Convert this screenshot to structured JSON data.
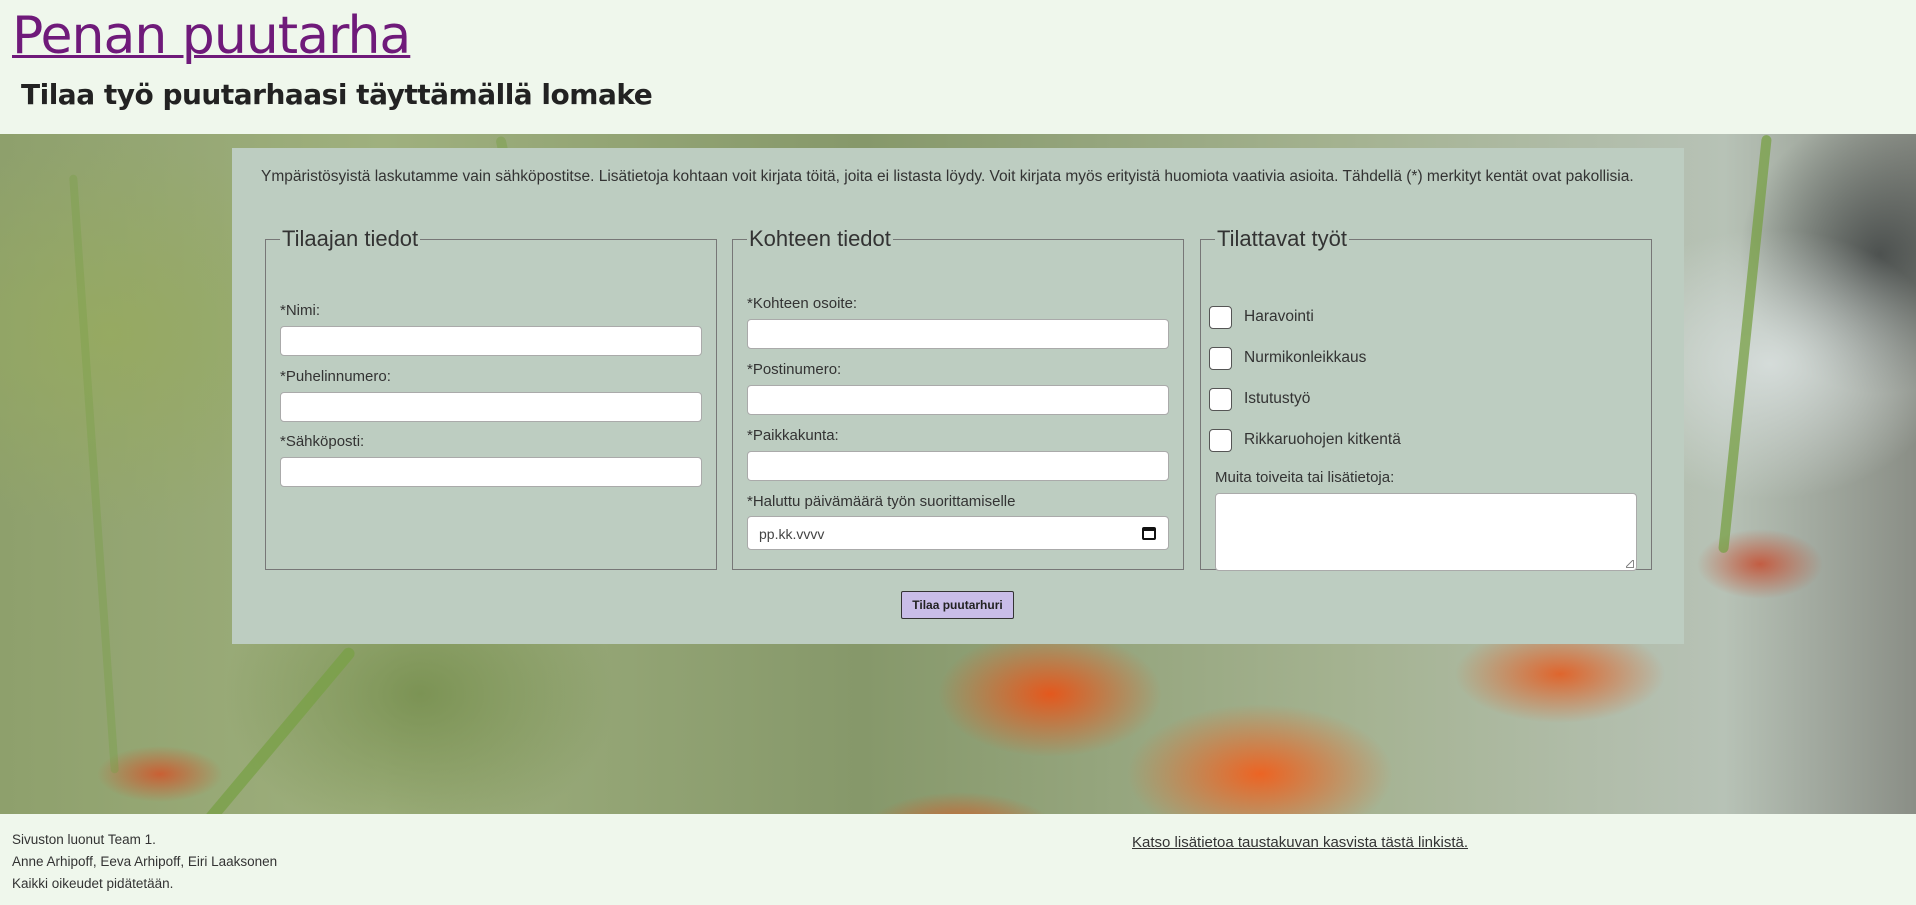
{
  "header": {
    "site_title": "Penan puutarha",
    "subtitle": "Tilaa työ puutarhaasi täyttämällä lomake"
  },
  "form": {
    "intro": "Ympäristösyistä laskutamme vain sähköpostitse. Lisätietoja kohtaan voit kirjata töitä, joita ei listasta löydy. Voit kirjata myös erityistä huomiota vaativia asioita. Tähdellä (*) merkityt kentät ovat pakollisia.",
    "customer": {
      "legend": "Tilaajan tiedot",
      "name_label": "*Nimi:",
      "phone_label": "*Puhelinnumero:",
      "email_label": "*Sähköposti:"
    },
    "site": {
      "legend": "Kohteen tiedot",
      "address_label": "*Kohteen osoite:",
      "postal_label": "*Postinumero:",
      "city_label": "*Paikkakunta:",
      "date_label": "*Haluttu päivämäärä työn suorittamiselle",
      "date_placeholder": "pp.kk.vvvv"
    },
    "jobs": {
      "legend": "Tilattavat työt",
      "options": [
        "Haravointi",
        "Nurmikonleikkaus",
        "Istutustyö",
        "Rikkaruohojen kitkentä"
      ],
      "notes_label": "Muita toiveita tai lisätietoja:"
    },
    "submit_label": "Tilaa puutarhuri"
  },
  "footer": {
    "line1": "Sivuston luonut Team 1.",
    "line2": "Anne Arhipoff, Eeva Arhipoff, Eiri Laaksonen",
    "line3": "Kaikki oikeudet pidätetään.",
    "link": "Katso lisätietoa taustakuvan kasvista tästä linkistä."
  },
  "colors": {
    "page_bg": "#eff7ec",
    "title_link": "#6f1a7a",
    "form_bg": "#bdcdc1",
    "button_bg": "#c9bde8"
  }
}
